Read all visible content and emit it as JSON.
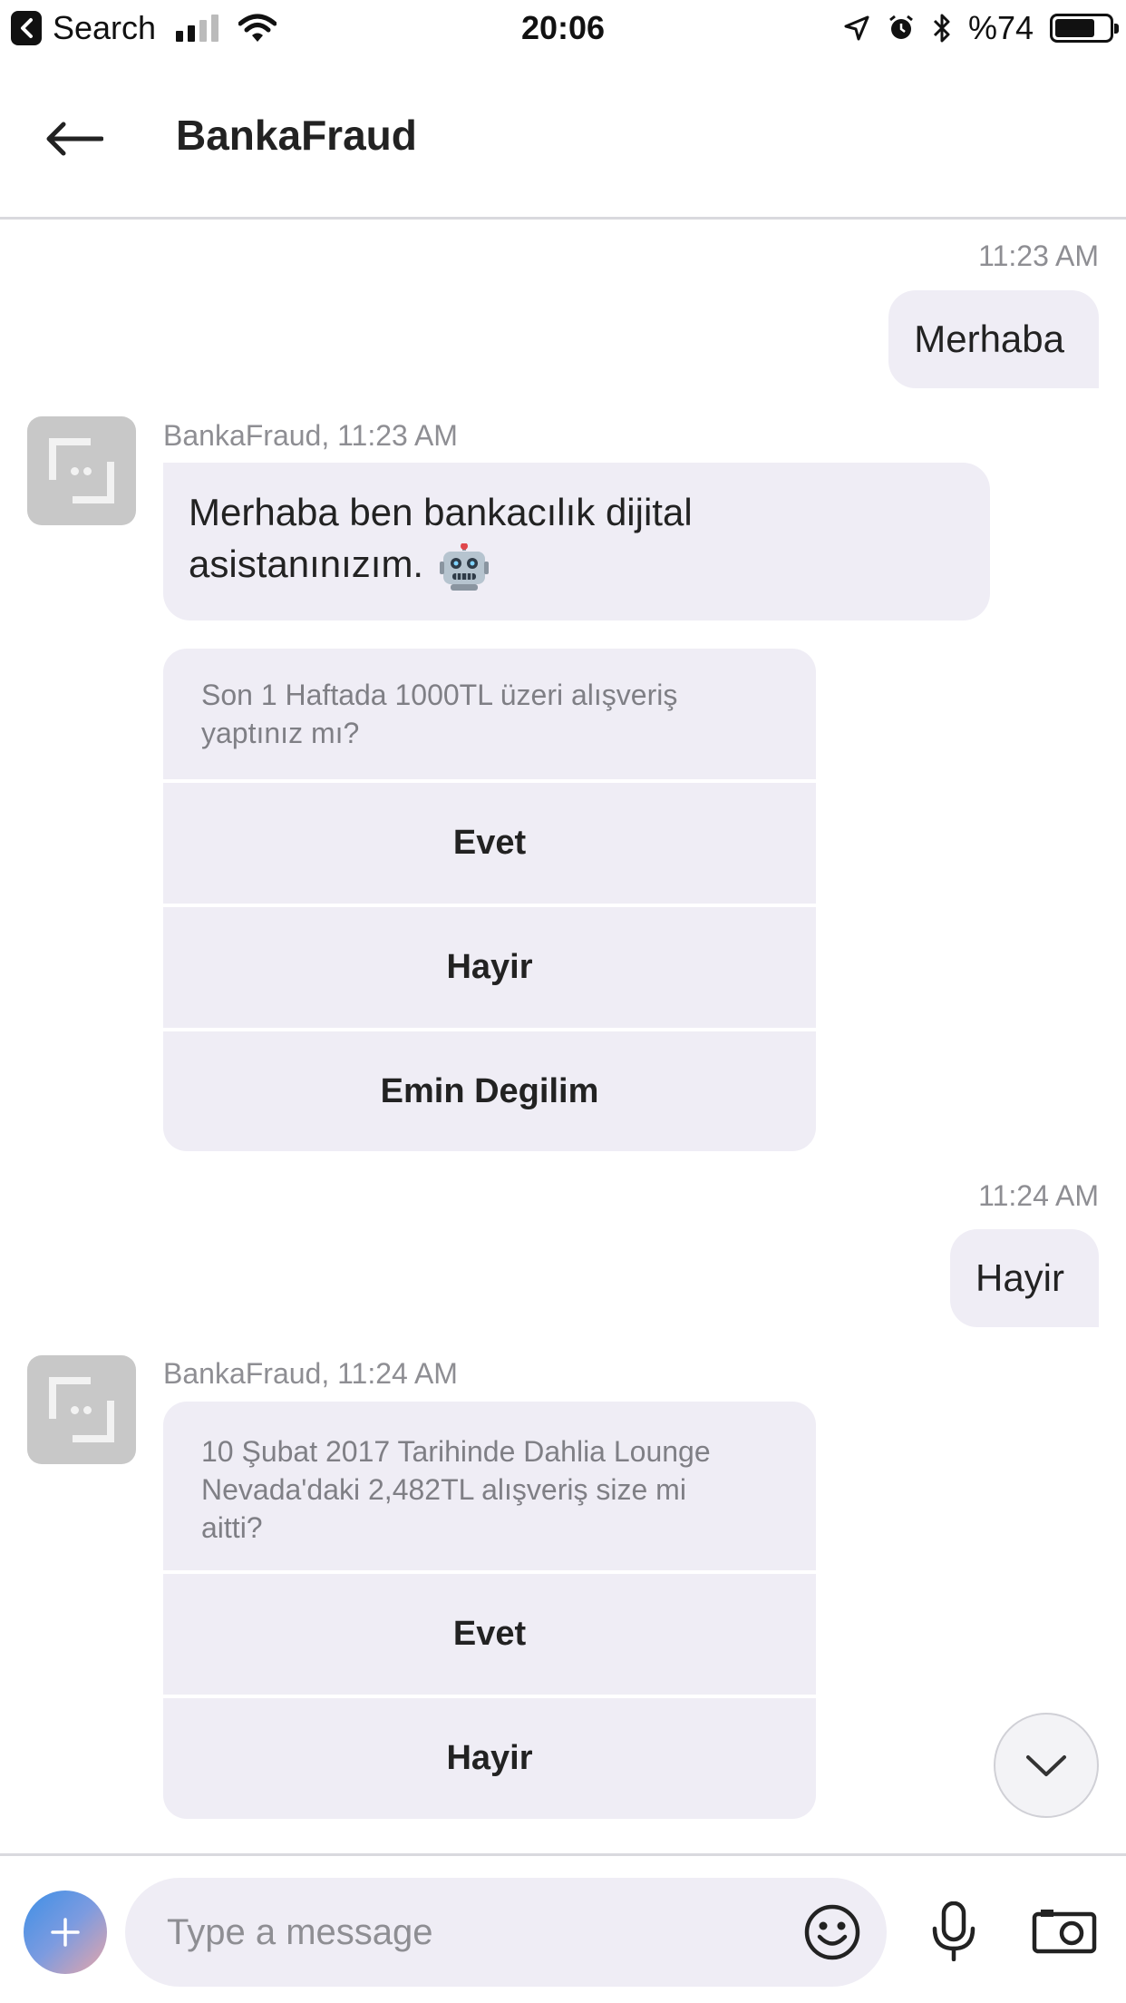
{
  "status_bar": {
    "back_app": "Search",
    "time": "20:06",
    "battery_text": "%74",
    "battery_level": 0.74
  },
  "header": {
    "title": "BankaFraud",
    "back_icon": "arrow-left-icon"
  },
  "messages": [
    {
      "type": "outgoing",
      "timestamp": "11:23 AM",
      "text": "Merhaba"
    },
    {
      "type": "incoming",
      "sender_line": "BankaFraud, 11:23 AM",
      "text_line1": "Merhaba ben bankacılık dijital",
      "text_line2": "asistanınızım.",
      "emoji": "robot-face-emoji"
    },
    {
      "type": "card",
      "question_line1": "Son 1 Haftada 1000TL üzeri alışveriş",
      "question_line2": "yaptınız mı?",
      "options": [
        "Evet",
        "Hayir",
        "Emin Degilim"
      ]
    },
    {
      "type": "outgoing",
      "timestamp": "11:24 AM",
      "text": "Hayir"
    },
    {
      "type": "card",
      "sender_line": "BankaFraud, 11:24 AM",
      "question_line1": "10 Şubat 2017 Tarihinde Dahlia Lounge",
      "question_line2": "Nevada'daki 2,482TL alışveriş size mi",
      "question_line3": "aitti?",
      "options": [
        "Evet",
        "Hayir"
      ]
    }
  ],
  "composer": {
    "placeholder": "Type a message",
    "icons": [
      "plus-icon",
      "emoji-icon",
      "microphone-icon",
      "camera-icon"
    ]
  },
  "colors": {
    "bubble": "#efedf5",
    "timestamp": "#8e8e93",
    "text": "#222222"
  }
}
